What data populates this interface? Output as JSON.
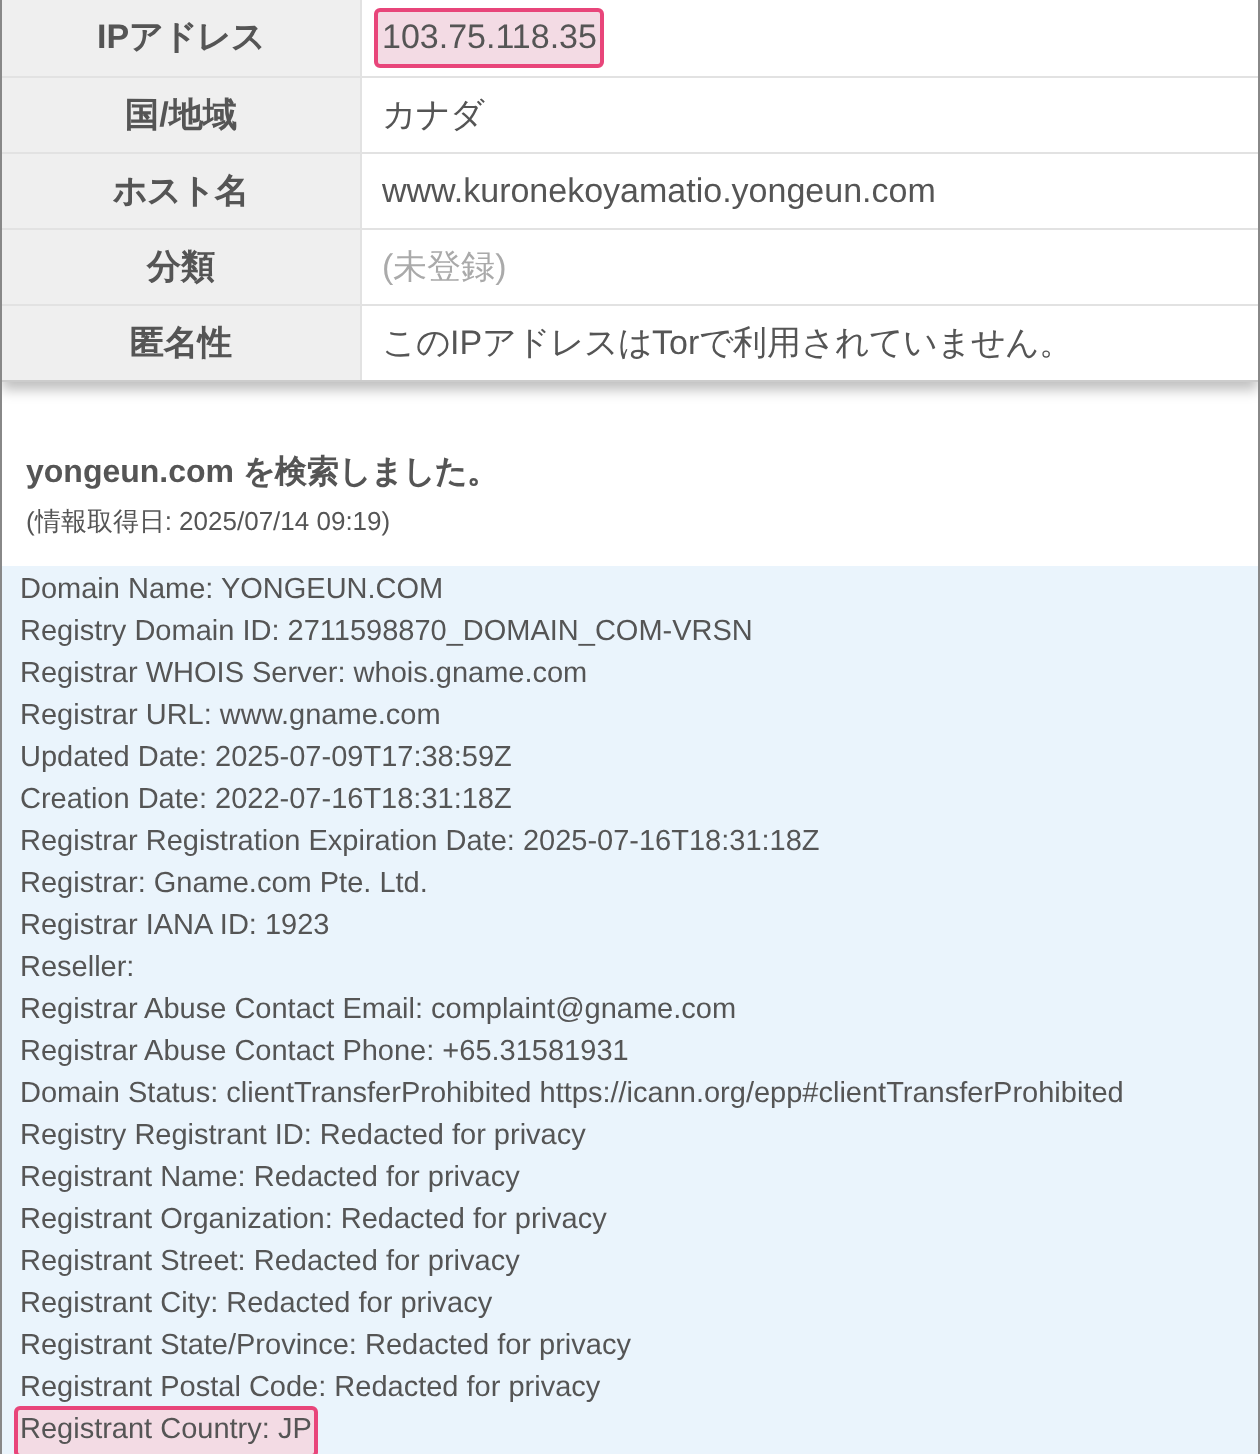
{
  "ip_table": {
    "rows": [
      {
        "label": "IPアドレス",
        "value": "103.75.118.35",
        "highlighted": true,
        "muted": false
      },
      {
        "label": "国/地域",
        "value": "カナダ",
        "highlighted": false,
        "muted": false
      },
      {
        "label": "ホスト名",
        "value": "www.kuronekoyamatio.yongeun.com",
        "highlighted": false,
        "muted": false
      },
      {
        "label": "分類",
        "value": "(未登録)",
        "highlighted": false,
        "muted": true
      },
      {
        "label": "匿名性",
        "value": "このIPアドレスはTorで利用されていません。",
        "highlighted": false,
        "muted": false
      }
    ]
  },
  "whois": {
    "title": "yongeun.com を検索しました。",
    "fetched": "(情報取得日: 2025/07/14 09:19)",
    "lines": [
      {
        "text": "Domain Name: YONGEUN.COM",
        "highlighted": false
      },
      {
        "text": "Registry Domain ID: 2711598870_DOMAIN_COM-VRSN",
        "highlighted": false
      },
      {
        "text": "Registrar WHOIS Server: whois.gname.com",
        "highlighted": false
      },
      {
        "text": "Registrar URL: www.gname.com",
        "highlighted": false
      },
      {
        "text": "Updated Date: 2025-07-09T17:38:59Z",
        "highlighted": false
      },
      {
        "text": "Creation Date: 2022-07-16T18:31:18Z",
        "highlighted": false
      },
      {
        "text": "Registrar Registration Expiration Date: 2025-07-16T18:31:18Z",
        "highlighted": false
      },
      {
        "text": "Registrar: Gname.com Pte. Ltd.",
        "highlighted": false
      },
      {
        "text": "Registrar IANA ID: 1923",
        "highlighted": false
      },
      {
        "text": "Reseller:",
        "highlighted": false
      },
      {
        "text": "Registrar Abuse Contact Email: complaint@gname.com",
        "highlighted": false
      },
      {
        "text": "Registrar Abuse Contact Phone: +65.31581931",
        "highlighted": false
      },
      {
        "text": "Domain Status: clientTransferProhibited https://icann.org/epp#clientTransferProhibited",
        "highlighted": false
      },
      {
        "text": "Registry Registrant ID: Redacted for privacy",
        "highlighted": false
      },
      {
        "text": "Registrant Name: Redacted for privacy",
        "highlighted": false
      },
      {
        "text": "Registrant Organization: Redacted for privacy",
        "highlighted": false
      },
      {
        "text": "Registrant Street: Redacted for privacy",
        "highlighted": false
      },
      {
        "text": "Registrant City: Redacted for privacy",
        "highlighted": false
      },
      {
        "text": "Registrant State/Province: Redacted for privacy",
        "highlighted": false
      },
      {
        "text": "Registrant Postal Code: Redacted for privacy",
        "highlighted": false
      },
      {
        "text": "Registrant Country: JP",
        "highlighted": true
      }
    ]
  }
}
